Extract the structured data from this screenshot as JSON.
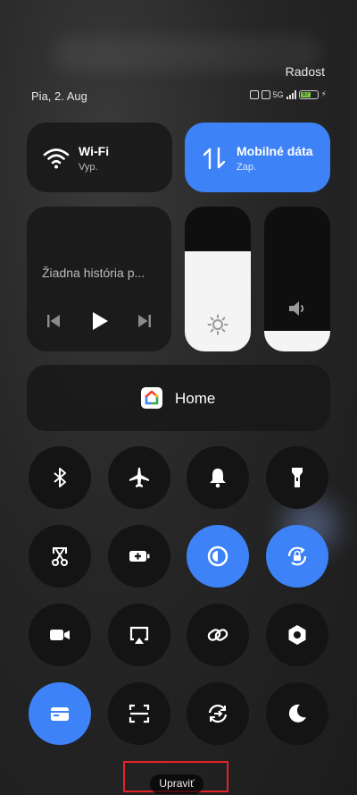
{
  "status_bar": {
    "carrier": "Radost",
    "date": "Pia, 2. Aug",
    "network": "5G",
    "battery": "67"
  },
  "tiles": {
    "wifi": {
      "title": "Wi-Fi",
      "status": "Vyp."
    },
    "mobile": {
      "title": "Mobilné dáta",
      "status": "Zap."
    }
  },
  "media": {
    "now_playing": "Žiadna história p..."
  },
  "sliders": {
    "brightness_level": 0.69,
    "volume_level": 0.14
  },
  "home": {
    "label": "Home"
  },
  "toggles": [
    {
      "name": "bluetooth",
      "icon": "bluetooth-icon",
      "on": false
    },
    {
      "name": "airplane",
      "icon": "airplane-icon",
      "on": false
    },
    {
      "name": "ring",
      "icon": "bell-icon",
      "on": false
    },
    {
      "name": "flashlight",
      "icon": "flashlight-icon",
      "on": false
    },
    {
      "name": "screenshot",
      "icon": "scissors-icon",
      "on": false
    },
    {
      "name": "battery-saver",
      "icon": "battery-plus-icon",
      "on": false
    },
    {
      "name": "contrast",
      "icon": "contrast-icon",
      "on": true
    },
    {
      "name": "rotation-lock",
      "icon": "rotation-lock-icon",
      "on": true
    },
    {
      "name": "screen-record",
      "icon": "video-camera-icon",
      "on": false
    },
    {
      "name": "cast",
      "icon": "cast-icon",
      "on": false
    },
    {
      "name": "link",
      "icon": "link-icon",
      "on": false
    },
    {
      "name": "settings",
      "icon": "hexagon-icon",
      "on": false
    },
    {
      "name": "wallet",
      "icon": "wallet-icon",
      "on": true
    },
    {
      "name": "scan",
      "icon": "scan-icon",
      "on": false
    },
    {
      "name": "sync",
      "icon": "sync-icon",
      "on": false
    },
    {
      "name": "dark-mode",
      "icon": "moon-icon",
      "on": false
    }
  ],
  "footer": {
    "edit_label": "Upraviť"
  },
  "colors": {
    "accent": "#3d82f6",
    "highlight": "#e2232a"
  }
}
